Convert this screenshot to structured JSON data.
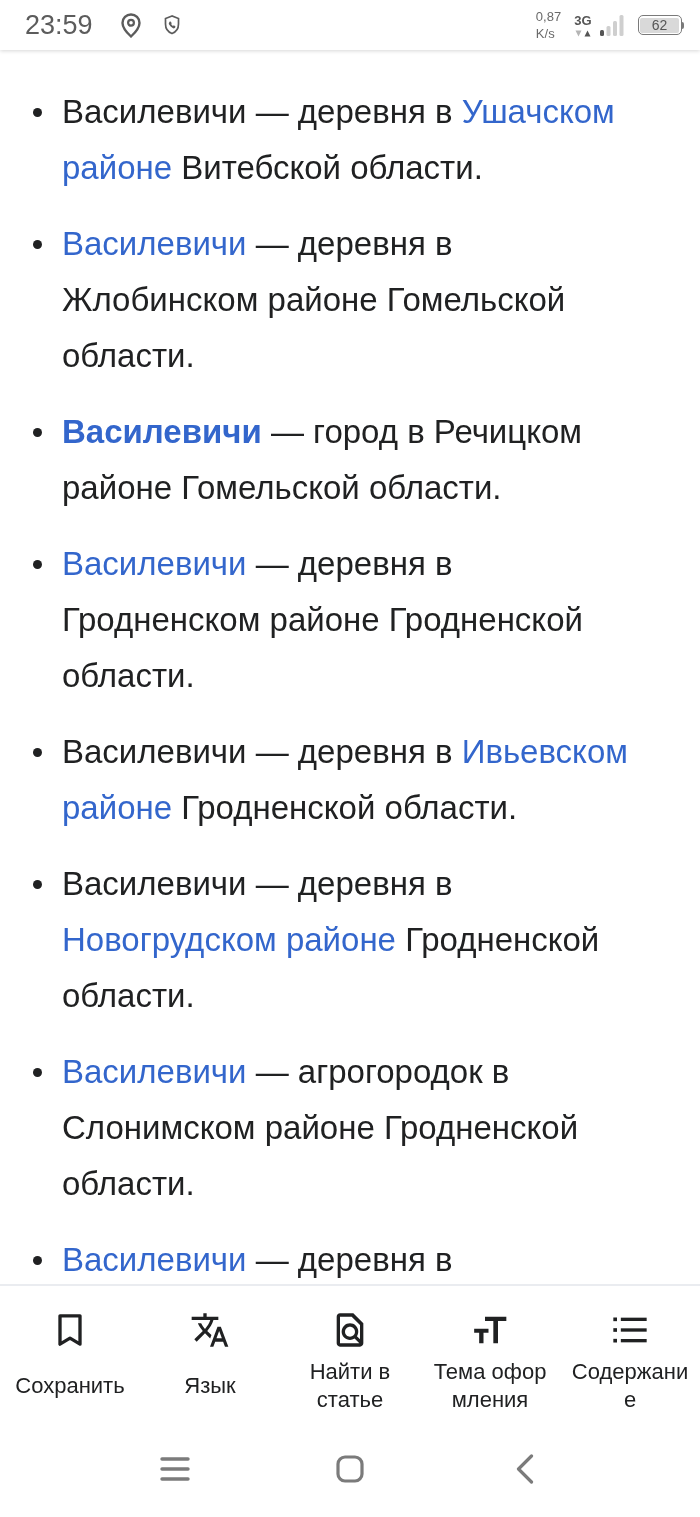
{
  "status_bar": {
    "time": "23:59",
    "speed": "0,87",
    "speed_unit": "K/s",
    "network": "3G",
    "battery": "62"
  },
  "article": {
    "items": [
      {
        "segments": [
          {
            "kind": "text",
            "text": "Василевичи — деревня в "
          },
          {
            "kind": "link",
            "text": "Ушачском районе"
          },
          {
            "kind": "text",
            "text": " Витебской области."
          }
        ]
      },
      {
        "segments": [
          {
            "kind": "link",
            "text": "Василевичи"
          },
          {
            "kind": "text",
            "text": " — деревня в Жлобинском районе Гомельской области."
          }
        ]
      },
      {
        "segments": [
          {
            "kind": "bold",
            "text": "Василевичи"
          },
          {
            "kind": "text",
            "text": " — город в Речицком районе Гомельской области."
          }
        ]
      },
      {
        "segments": [
          {
            "kind": "link",
            "text": "Василевичи"
          },
          {
            "kind": "text",
            "text": " — деревня в Гродненском районе Гродненской области."
          }
        ]
      },
      {
        "segments": [
          {
            "kind": "text",
            "text": "Василевичи — деревня в "
          },
          {
            "kind": "link",
            "text": "Ивьевском районе"
          },
          {
            "kind": "text",
            "text": " Гродненской области."
          }
        ]
      },
      {
        "segments": [
          {
            "kind": "text",
            "text": "Василевичи — деревня в "
          },
          {
            "kind": "link",
            "text": "Новогрудском районе"
          },
          {
            "kind": "text",
            "text": " Гродненской области."
          }
        ]
      },
      {
        "segments": [
          {
            "kind": "link",
            "text": "Василевичи"
          },
          {
            "kind": "text",
            "text": " — агрогородок в Слонимском районе Гродненской области."
          }
        ]
      },
      {
        "segments": [
          {
            "kind": "link",
            "text": "Василевичи"
          },
          {
            "kind": "text",
            "text": " — деревня в"
          }
        ]
      }
    ]
  },
  "toolbar": [
    {
      "label": "Сохранить"
    },
    {
      "label": "Язык"
    },
    {
      "label": "Найти в статье"
    },
    {
      "label": "Тема оформления"
    },
    {
      "label": "Содержание"
    }
  ]
}
